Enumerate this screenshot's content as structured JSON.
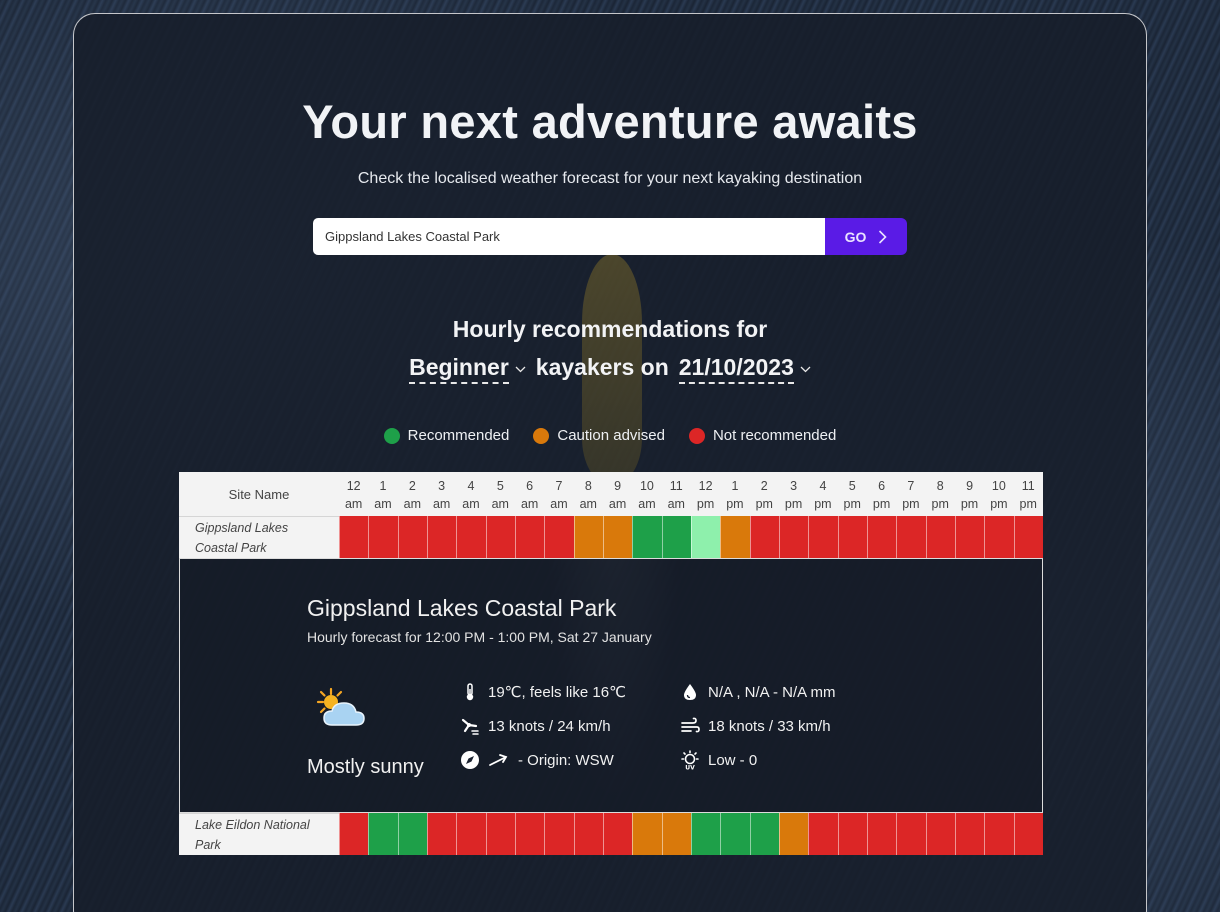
{
  "hero": {
    "title": "Your next adventure awaits",
    "subtitle": "Check the localised weather forecast for your next kayaking destination"
  },
  "search": {
    "value": "Gippsland Lakes Coastal Park",
    "go_label": "GO"
  },
  "recommendations": {
    "heading": "Hourly recommendations for",
    "level": "Beginner",
    "middle_text": "kayakers on",
    "date": "21/10/2023"
  },
  "legend": [
    {
      "label": "Recommended",
      "color": "#1ea049"
    },
    {
      "label": "Caution advised",
      "color": "#d9790b"
    },
    {
      "label": "Not recommended",
      "color": "#dc2626"
    }
  ],
  "table": {
    "site_header": "Site Name",
    "hours": [
      {
        "h": "12",
        "p": "am"
      },
      {
        "h": "1",
        "p": "am"
      },
      {
        "h": "2",
        "p": "am"
      },
      {
        "h": "3",
        "p": "am"
      },
      {
        "h": "4",
        "p": "am"
      },
      {
        "h": "5",
        "p": "am"
      },
      {
        "h": "6",
        "p": "am"
      },
      {
        "h": "7",
        "p": "am"
      },
      {
        "h": "8",
        "p": "am"
      },
      {
        "h": "9",
        "p": "am"
      },
      {
        "h": "10",
        "p": "am"
      },
      {
        "h": "11",
        "p": "am"
      },
      {
        "h": "12",
        "p": "pm"
      },
      {
        "h": "1",
        "p": "pm"
      },
      {
        "h": "2",
        "p": "pm"
      },
      {
        "h": "3",
        "p": "pm"
      },
      {
        "h": "4",
        "p": "pm"
      },
      {
        "h": "5",
        "p": "pm"
      },
      {
        "h": "6",
        "p": "pm"
      },
      {
        "h": "7",
        "p": "pm"
      },
      {
        "h": "8",
        "p": "pm"
      },
      {
        "h": "9",
        "p": "pm"
      },
      {
        "h": "10",
        "p": "pm"
      },
      {
        "h": "11",
        "p": "pm"
      }
    ],
    "rows": [
      {
        "site": "Gippsland Lakes Coastal Park",
        "status": [
          "red",
          "red",
          "red",
          "red",
          "red",
          "red",
          "red",
          "red",
          "orange",
          "orange",
          "green",
          "green",
          "lightgreen",
          "orange",
          "red",
          "red",
          "red",
          "red",
          "red",
          "red",
          "red",
          "red",
          "red",
          "red"
        ]
      },
      {
        "site": "Lake Eildon National Park",
        "status": [
          "red",
          "green",
          "green",
          "red",
          "red",
          "red",
          "red",
          "red",
          "red",
          "red",
          "orange",
          "orange",
          "green",
          "green",
          "green",
          "orange",
          "red",
          "red",
          "red",
          "red",
          "red",
          "red",
          "red",
          "red"
        ]
      }
    ]
  },
  "status_colors": {
    "green": "#1ea049",
    "lightgreen": "#8ef0ac",
    "orange": "#d9790b",
    "red": "#dc2626"
  },
  "detail": {
    "title": "Gippsland Lakes Coastal Park",
    "subtitle": "Hourly forecast for 12:00 PM - 1:00 PM, Sat 27 January",
    "condition": "Mostly sunny",
    "condition_icon": "partly-cloudy-icon",
    "temperature": "19℃, feels like 16℃",
    "rain": "N/A , N/A - N/A mm",
    "wind": "13 knots / 24 km/h",
    "gust": "18 knots / 33 km/h",
    "direction": "- Origin: WSW",
    "uv": "Low - 0"
  }
}
